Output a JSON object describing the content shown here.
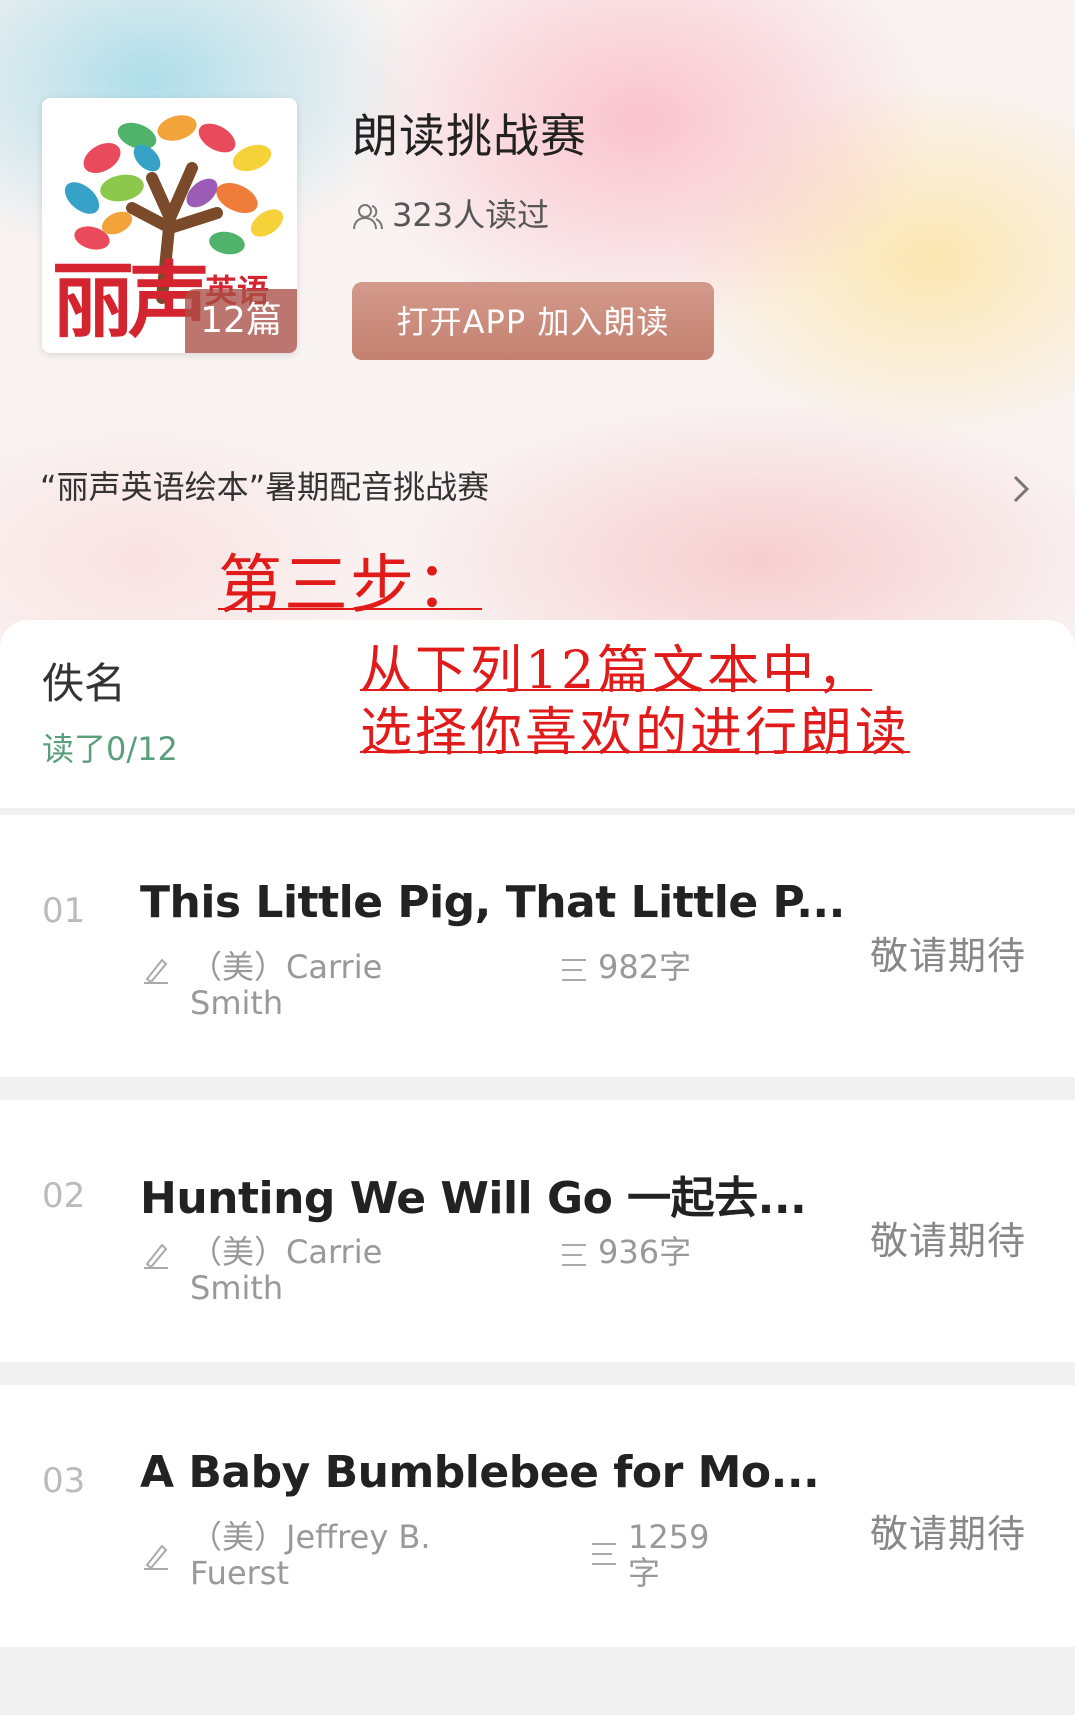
{
  "book": {
    "title": "朗读挑战赛",
    "readers": "323人读过",
    "open_button": "打开APP 加入朗读",
    "description": "“丽声英语绘本”暑期配音挑战赛",
    "cover": {
      "logo_text": "丽声",
      "logo_sub": "英语",
      "count_badge": "12篇"
    }
  },
  "annotation": {
    "step": "第三步：",
    "line1": "从下列12篇文本中，",
    "line2": "选择你喜欢的进行朗读"
  },
  "reader": {
    "name": "佚名",
    "progress": "读了0/12"
  },
  "items": [
    {
      "num": "01",
      "title": "This Little Pig, That Little P...",
      "author": "（美）Carrie Smith",
      "words": "982字",
      "status": "敬请期待"
    },
    {
      "num": "02",
      "title": "Hunting We Will Go 一起去...",
      "author": "（美）Carrie Smith",
      "words": "936字",
      "status": "敬请期待"
    },
    {
      "num": "03",
      "title": "A Baby Bumblebee for Mo...",
      "author": "（美）Jeffrey B. Fuerst",
      "words": "1259字",
      "status": "敬请期待"
    }
  ],
  "colors": {
    "annotation_red": "#e11a1a",
    "progress_green": "#5b9e7c",
    "button": "#c4806f",
    "logo_red": "#d3242f"
  },
  "icons": [
    "readers-icon",
    "chevron-right-icon",
    "pen-icon",
    "lines-icon"
  ]
}
